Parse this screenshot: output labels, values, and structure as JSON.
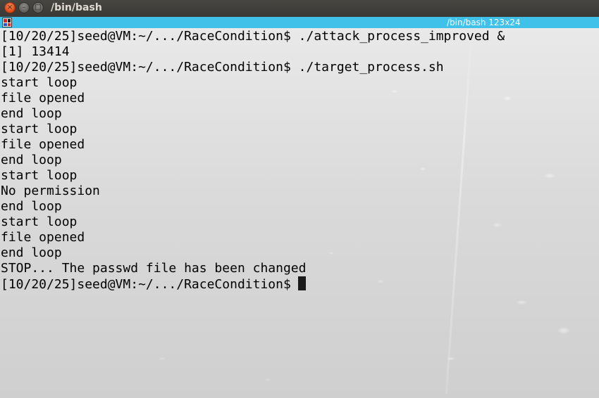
{
  "window": {
    "title": "/bin/bash",
    "buttons": {
      "close": "×",
      "minimize": "–",
      "maximize": "□"
    }
  },
  "tab": {
    "label": "/bin/bash 123x24",
    "icon": "terminal-app-icon"
  },
  "terminal": {
    "lines": [
      "[10/20/25]seed@VM:~/.../RaceCondition$ ./attack_process_improved &",
      "[1] 13414",
      "[10/20/25]seed@VM:~/.../RaceCondition$ ./target_process.sh",
      "start loop",
      "file opened",
      "end loop",
      "start loop",
      "file opened",
      "end loop",
      "start loop",
      "No permission",
      "end loop",
      "start loop",
      "file opened",
      "end loop",
      "STOP... The passwd file has been changed"
    ],
    "prompt": "[10/20/25]seed@VM:~/.../RaceCondition$"
  },
  "colors": {
    "titlebar": "#3c3b37",
    "close_button": "#dd4814",
    "tabbar": "#3fc1ea",
    "text": "#000000"
  }
}
